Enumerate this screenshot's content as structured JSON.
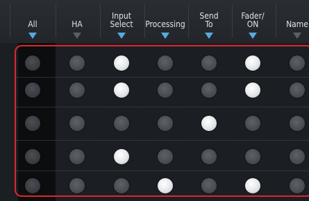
{
  "columns": [
    {
      "key": "all",
      "label": "All",
      "active": true
    },
    {
      "key": "ha",
      "label": "HA",
      "active": false
    },
    {
      "key": "input_select",
      "label": "Input\nSelect",
      "active": true
    },
    {
      "key": "processing",
      "label": "Processing",
      "active": true
    },
    {
      "key": "send_to",
      "label": "Send\nTo",
      "active": true
    },
    {
      "key": "fader_on",
      "label": "Fader/\nON",
      "active": true
    },
    {
      "key": "name",
      "label": "Name",
      "active": false
    }
  ],
  "rows": [
    [
      false,
      false,
      true,
      false,
      false,
      true,
      false
    ],
    [
      false,
      false,
      true,
      false,
      false,
      true,
      false
    ],
    [
      false,
      false,
      false,
      false,
      true,
      false,
      false
    ],
    [
      false,
      false,
      true,
      false,
      false,
      false,
      false
    ],
    [
      false,
      false,
      false,
      true,
      false,
      true,
      false
    ]
  ],
  "colors": {
    "accent": "#5aa8e0",
    "highlight_frame": "#e0262c",
    "background": "#1b1e22"
  }
}
